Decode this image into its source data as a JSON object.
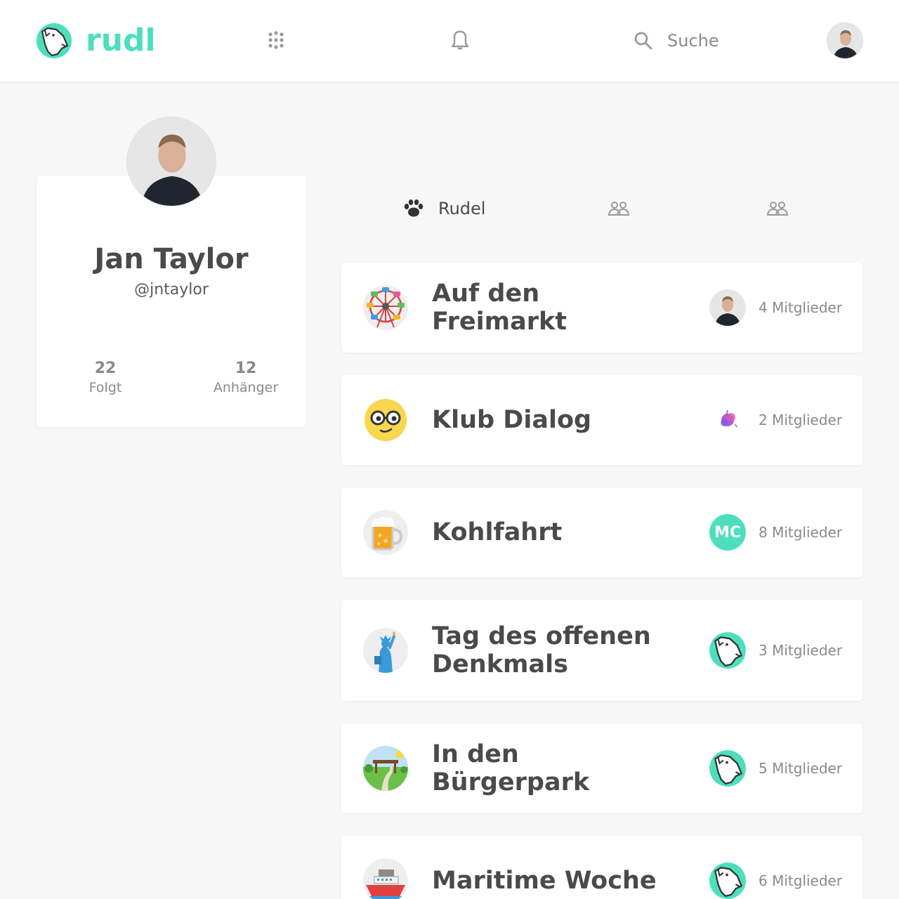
{
  "app": {
    "name": "rudl",
    "brand_color": "#4ddfbd"
  },
  "header": {
    "icons": [
      "logo-wolf-icon",
      "grid-dots-icon",
      "bell-icon",
      "search-icon"
    ],
    "search_placeholder": "Suche",
    "user_avatar": "user-avatar"
  },
  "profile": {
    "name": "Jan Taylor",
    "handle": "@jntaylor",
    "stats": [
      {
        "value": "22",
        "label": "Folgt"
      },
      {
        "value": "12",
        "label": "Anhänger"
      }
    ]
  },
  "tabs": [
    {
      "label": "Rudel",
      "icon": "paw-icon",
      "active": true
    },
    {
      "label": "",
      "icon": "users-icon",
      "active": false
    },
    {
      "label": "",
      "icon": "users-icon",
      "active": false
    }
  ],
  "groups": [
    {
      "title": "Auf den Freimarkt",
      "icon": "ferris-wheel-icon",
      "member_avatar": "photo",
      "count": "4 Mitglieder"
    },
    {
      "title": "Klub Dialog",
      "icon": "nerd-face-icon",
      "member_avatar": "splash",
      "count": "2 Mitglieder"
    },
    {
      "title": "Kohlfahrt",
      "icon": "beer-mug-icon",
      "member_avatar": "initials",
      "initials": "MC",
      "count": "8 Mitglieder"
    },
    {
      "title": "Tag des offenen Denkmals",
      "icon": "statue-of-liberty-icon",
      "member_avatar": "wolf",
      "count": "3 Mitglieder"
    },
    {
      "title": "In den Bürgerpark",
      "icon": "park-icon",
      "member_avatar": "wolf",
      "count": "5 Mitglieder"
    },
    {
      "title": "Maritime Woche",
      "icon": "ship-icon",
      "member_avatar": "wolf",
      "count": "6 Mitglieder"
    }
  ]
}
